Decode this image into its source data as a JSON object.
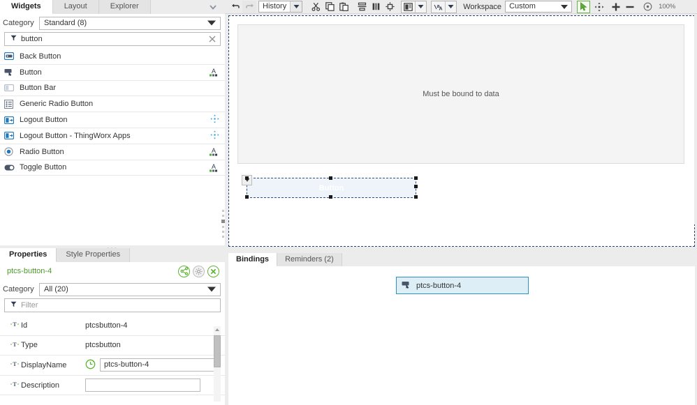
{
  "widgets_panel": {
    "tabs": [
      {
        "label": "Widgets",
        "active": true
      },
      {
        "label": "Layout",
        "active": false
      },
      {
        "label": "Explorer",
        "active": false
      }
    ],
    "collapse_icon": "chevron-down-icon",
    "category": {
      "label": "Category",
      "value": "Standard (8)"
    },
    "filter": {
      "icon": "funnel-icon",
      "value": "button",
      "placeholder": "Filter",
      "clear_icon": "close-icon"
    },
    "items": [
      {
        "name": "Back Button",
        "icon": "back-button-widget-icon",
        "badge": ""
      },
      {
        "name": "Button",
        "icon": "button-widget-icon",
        "badge": "style-theme-icon"
      },
      {
        "name": "Button Bar",
        "icon": "button-bar-widget-icon",
        "badge": ""
      },
      {
        "name": "Generic Radio Button",
        "icon": "generic-radio-button-widget-icon",
        "badge": ""
      },
      {
        "name": "Logout Button",
        "icon": "logout-button-widget-icon",
        "badge": "move-icon"
      },
      {
        "name": "Logout Button - ThingWorx Apps",
        "icon": "logout-button-thingworx-apps-widget-icon",
        "badge": "move-icon"
      },
      {
        "name": "Radio Button",
        "icon": "radio-button-widget-icon",
        "badge": "style-theme-icon"
      },
      {
        "name": "Toggle Button",
        "icon": "toggle-button-widget-icon",
        "badge": "style-theme-icon"
      }
    ]
  },
  "properties_panel": {
    "tabs": [
      {
        "label": "Properties",
        "active": true
      },
      {
        "label": "Style Properties",
        "active": false
      }
    ],
    "selected_name": "ptcs-button-4",
    "selected_name_color": "#4d9a2a",
    "actions": [
      {
        "name": "bind-icon",
        "style": "green"
      },
      {
        "name": "gear-icon",
        "style": "gray"
      },
      {
        "name": "close-icon",
        "style": "green"
      }
    ],
    "category": {
      "label": "Category",
      "value": "All (20)"
    },
    "filter": {
      "icon": "funnel-icon",
      "value": "",
      "placeholder": "Filter"
    },
    "rows": [
      {
        "icon": "text-type-icon",
        "name": "Id",
        "value": "ptcsbutton-4",
        "editable": false,
        "refresh": false
      },
      {
        "icon": "text-type-icon",
        "name": "Type",
        "value": "ptcsbutton",
        "editable": false,
        "refresh": false
      },
      {
        "icon": "text-type-icon",
        "name": "DisplayName",
        "value": "ptcs-button-4",
        "editable": true,
        "refresh": true
      },
      {
        "icon": "text-type-icon",
        "name": "Description",
        "value": "",
        "editable": true,
        "refresh": false
      }
    ]
  },
  "toolbar": {
    "undo_icon": "undo-icon",
    "redo_icon": "redo-icon",
    "history": {
      "label": "History",
      "caret_icon": "caret-down-icon"
    },
    "cut_icon": "scissors-icon",
    "copy_icon": "copy-icon",
    "paste_icon": "paste-icon",
    "align_icon": "align-horizontal-icon",
    "distribute_icon": "distribute-vertical-icon",
    "fit_icon": "fit-to-size-icon",
    "layout_split": {
      "main_icon": "layout-icon",
      "caret_icon": "caret-down-icon"
    },
    "theme_split": {
      "main_icon": "theme-text-icon",
      "caret_icon": "caret-down-icon"
    },
    "workspace": {
      "label": "Workspace",
      "value": "Custom",
      "caret_icon": "caret-down-icon"
    },
    "select_tool_icon": "cursor-arrow-icon",
    "pan_tool_icon": "move-cross-icon",
    "zoom_in_icon": "plus-icon",
    "zoom_out_icon": "minus-icon",
    "zoom_reset_icon": "target-icon",
    "zoom_level": "100%"
  },
  "canvas": {
    "mashup_placeholder": "Must be bound to data",
    "selected_widget": {
      "label": "Button",
      "dropdown_icon": "widget-menu-icon"
    }
  },
  "bindings_panel": {
    "tabs": [
      {
        "label": "Bindings",
        "active": true
      },
      {
        "label": "Reminders (2)",
        "active": false
      }
    ],
    "nodes": [
      {
        "label": "ptcs-button-4",
        "icon": "button-widget-icon"
      }
    ]
  },
  "colors": {
    "accent_green": "#5cb531",
    "node_border_blue": "#2e93c4",
    "node_fill_blue": "#ddeef7",
    "selection_blue": "#2d4c8c",
    "panel_bg": "#ececec"
  }
}
